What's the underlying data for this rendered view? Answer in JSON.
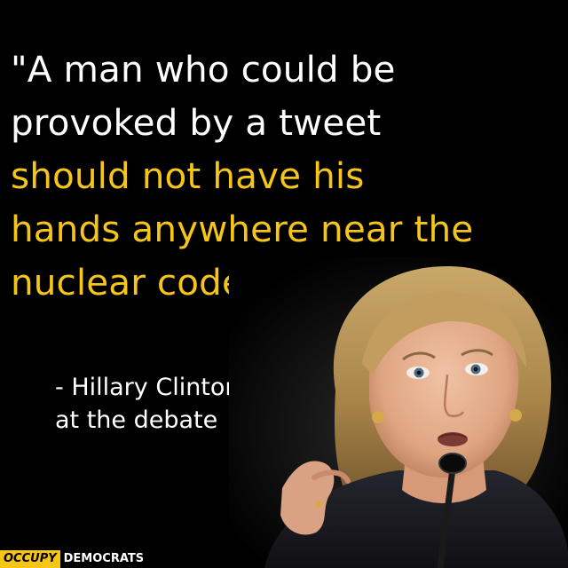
{
  "quote": {
    "lines": [
      "\"A man who could be",
      "provoked by a tweet",
      "should not have his",
      "hands anywhere near the",
      "nuclear codes.\""
    ],
    "colors": {
      "white": "#ffffff",
      "highlight": "#f5c518"
    }
  },
  "attribution": {
    "line1": "- Hillary Clinton,",
    "line2": "at the debate"
  },
  "photo": {
    "subject": "woman speaking into microphone"
  },
  "logo": {
    "occupy": "OCCUPY",
    "democrats": "DEMOCRATS",
    "accent": "#f5c518"
  }
}
